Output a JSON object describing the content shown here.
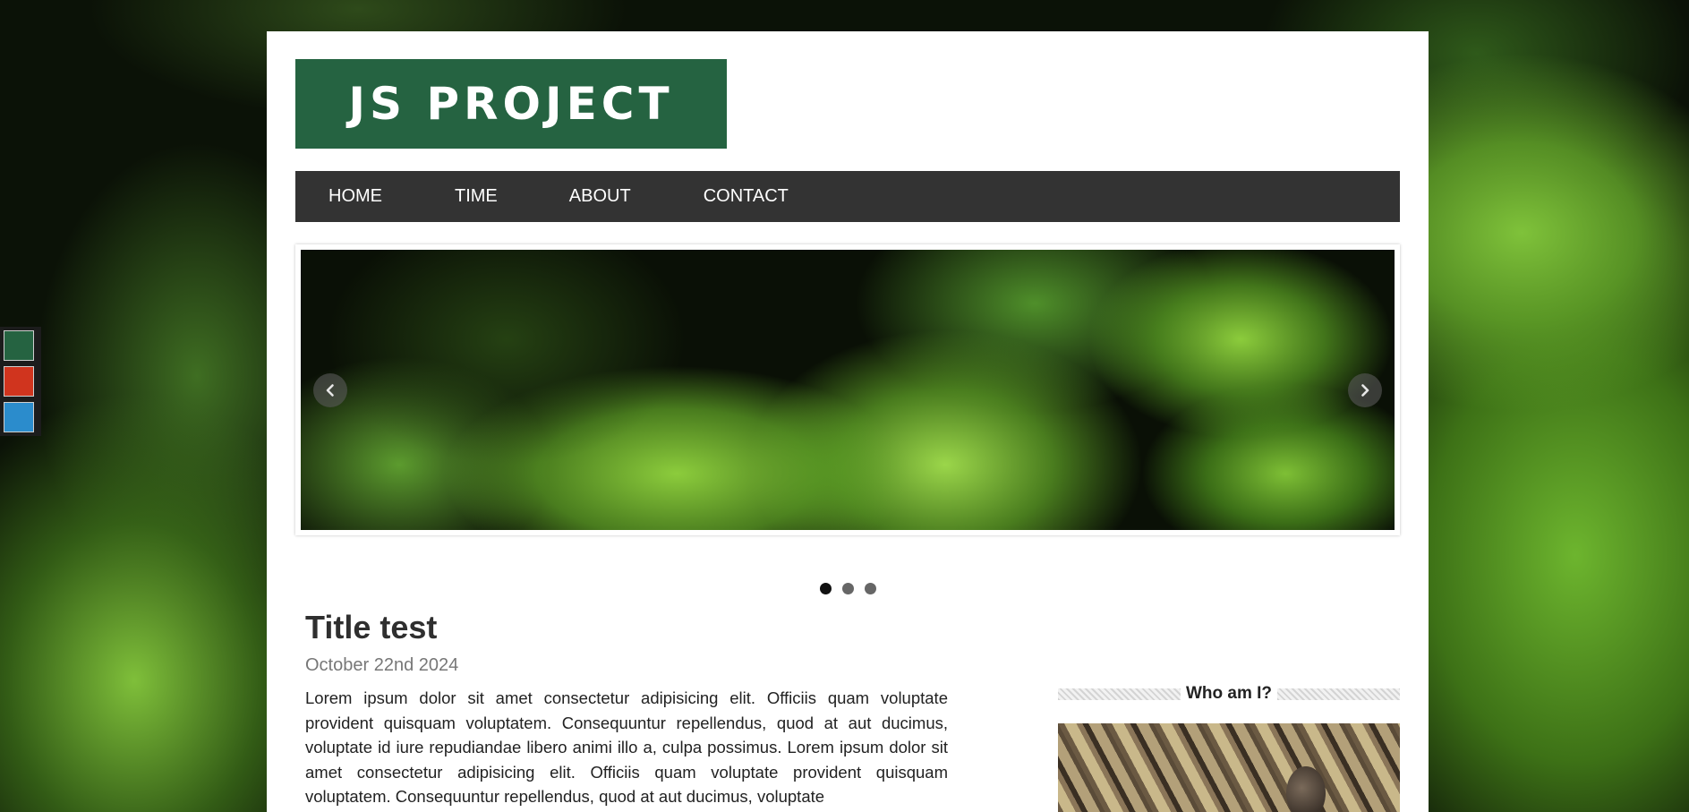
{
  "theme_switcher": {
    "swatches": [
      {
        "name": "green",
        "color": "#256341"
      },
      {
        "name": "red",
        "color": "#d0341e"
      },
      {
        "name": "blue",
        "color": "#2b8ccc"
      }
    ]
  },
  "header": {
    "logo_text": "JS PROJECT",
    "brand_color": "#256341"
  },
  "nav": {
    "items": [
      {
        "label": "HOME"
      },
      {
        "label": "TIME"
      },
      {
        "label": "ABOUT"
      },
      {
        "label": "CONTACT"
      }
    ]
  },
  "slider": {
    "prev_icon": "chevron-left-icon",
    "next_icon": "chevron-right-icon",
    "slide_count": 3,
    "active_index": 0
  },
  "post": {
    "title": "Title test",
    "date": "October 22nd 2024",
    "body": "Lorem ipsum dolor sit amet consectetur adipisicing elit. Officiis quam voluptate provident quisquam voluptatem. Consequuntur repellendus, quod at aut ducimus, voluptate id iure repudiandae libero animi illo a, culpa possimus. Lorem ipsum dolor sit amet consectetur adipisicing elit. Officiis quam voluptate provident quisquam voluptatem. Consequuntur repellendus, quod at aut ducimus, voluptate"
  },
  "sidebar": {
    "heading": "Who am I?"
  }
}
